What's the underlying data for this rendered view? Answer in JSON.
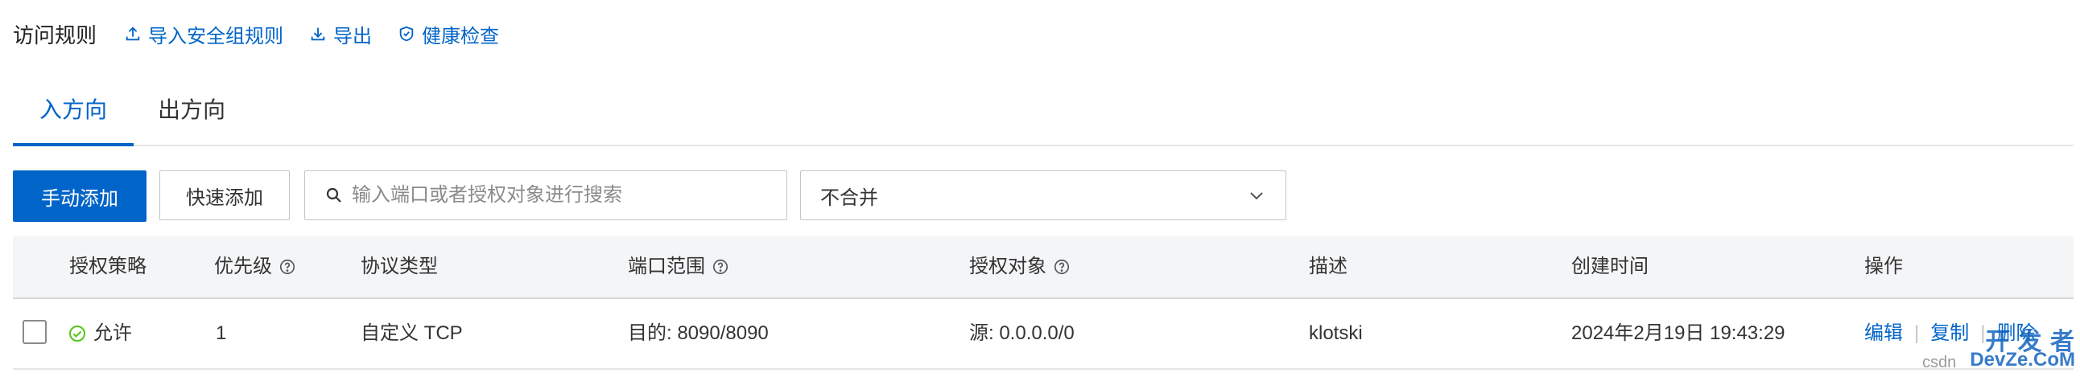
{
  "header": {
    "title": "访问规则",
    "actions": [
      {
        "label": "导入安全组规则",
        "icon": "upload-icon"
      },
      {
        "label": "导出",
        "icon": "download-icon"
      },
      {
        "label": "健康检查",
        "icon": "shield-check-icon"
      }
    ]
  },
  "tabs": [
    {
      "label": "入方向",
      "active": true
    },
    {
      "label": "出方向",
      "active": false
    }
  ],
  "toolbar": {
    "manual_add_label": "手动添加",
    "quick_add_label": "快速添加",
    "search_placeholder": "输入端口或者授权对象进行搜索",
    "merge_select_value": "不合并"
  },
  "table": {
    "columns": {
      "policy": "授权策略",
      "priority": "优先级",
      "protocol": "协议类型",
      "port_range": "端口范围",
      "auth_object": "授权对象",
      "description": "描述",
      "created": "创建时间",
      "actions": "操作"
    },
    "rows": [
      {
        "policy": "允许",
        "priority": "1",
        "protocol": "自定义 TCP",
        "port_range": "目的: 8090/8090",
        "auth_object": "源: 0.0.0.0/0",
        "description": "klotski",
        "created": "2024年2月19日 19:43:29",
        "actions": {
          "edit": "编辑",
          "copy": "复制",
          "delete": "删除"
        }
      }
    ]
  },
  "watermark": {
    "main": "开 发 者",
    "sub": "DevZe.CoM",
    "csdn": "csdn"
  },
  "colors": {
    "accent": "#0064c8",
    "allow": "#52c41a",
    "header_bg": "#f4f5f7"
  }
}
